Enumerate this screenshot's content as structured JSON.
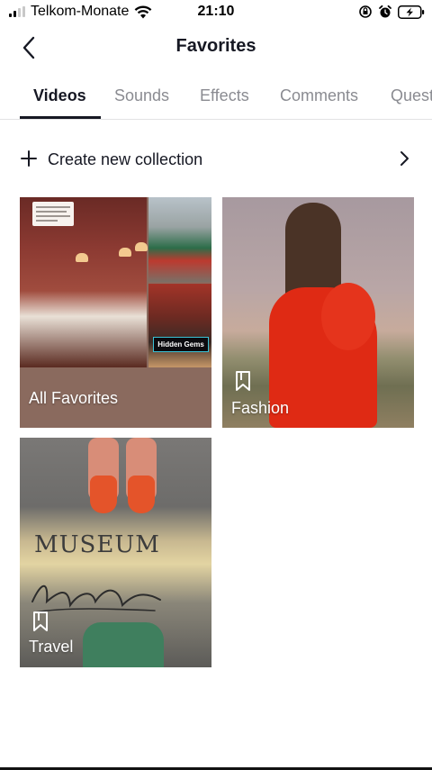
{
  "status_bar": {
    "carrier": "Telkom-Monate",
    "time": "21:10"
  },
  "header": {
    "title": "Favorites"
  },
  "tabs": [
    {
      "label": "Videos",
      "active": true
    },
    {
      "label": "Sounds",
      "active": false
    },
    {
      "label": "Effects",
      "active": false
    },
    {
      "label": "Comments",
      "active": false
    },
    {
      "label": "Questions",
      "active": false
    }
  ],
  "create_collection": {
    "label": "Create new collection"
  },
  "collections": [
    {
      "name": "All Favorites",
      "badge": "Hidden Gems"
    },
    {
      "name": "Fashion"
    },
    {
      "name": "Travel",
      "sign_text": "MUSEUM"
    }
  ],
  "colors": {
    "text_primary": "#161823",
    "text_secondary": "#8a8b91",
    "divider": "#e3e3e4",
    "all_favorites_overlay": "#8a6a5e"
  }
}
